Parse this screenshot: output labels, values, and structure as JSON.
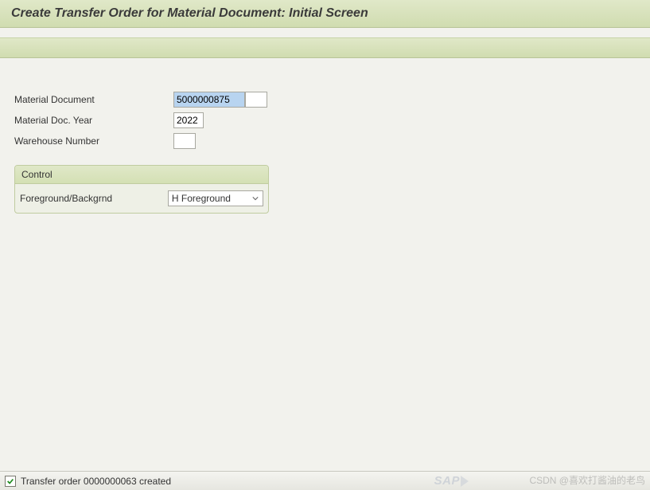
{
  "header": {
    "title": "Create Transfer Order for Material Document: Initial Screen"
  },
  "fields": {
    "material_document": {
      "label": "Material Document",
      "value": "5000000875",
      "secondary_value": ""
    },
    "material_doc_year": {
      "label": "Material Doc. Year",
      "value": "2022"
    },
    "warehouse_number": {
      "label": "Warehouse Number",
      "value": ""
    }
  },
  "control": {
    "group_title": "Control",
    "fg_bg": {
      "label": "Foreground/Backgrnd",
      "value": "H Foreground"
    }
  },
  "status": {
    "message": "Transfer order 0000000063 created"
  },
  "branding": {
    "sap": "SAP"
  },
  "watermark": "CSDN @喜欢打酱油的老鸟"
}
